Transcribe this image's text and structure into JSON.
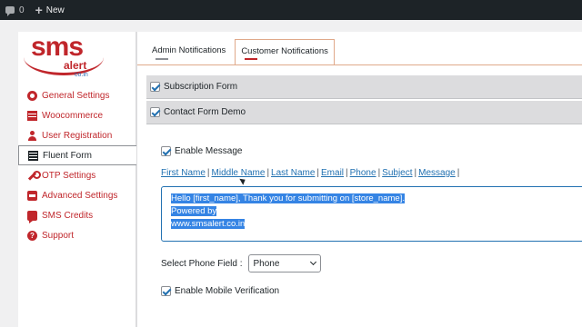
{
  "adminbar": {
    "comments_count": "0",
    "new_label": "New"
  },
  "logo": {
    "text_sms": "sms",
    "text_alert": "alert",
    "text_domain": "co.in"
  },
  "sidebar": {
    "items": [
      {
        "label": "General Settings",
        "icon": "gear-icon"
      },
      {
        "label": "Woocommerce",
        "icon": "table-icon"
      },
      {
        "label": "User Registration",
        "icon": "user-icon"
      },
      {
        "label": "Fluent Form",
        "icon": "form-icon",
        "active": true
      },
      {
        "label": "OTP Settings",
        "icon": "wrench-icon"
      },
      {
        "label": "Advanced Settings",
        "icon": "advanced-icon"
      },
      {
        "label": "SMS Credits",
        "icon": "chat-icon"
      },
      {
        "label": "Support",
        "icon": "help-icon"
      }
    ]
  },
  "tabs": [
    {
      "label": "Admin Notifications"
    },
    {
      "label": "Customer Notifications",
      "active": true
    }
  ],
  "accordions": [
    {
      "label": "Subscription Form",
      "checked": true
    },
    {
      "label": "Contact Form Demo",
      "checked": true
    }
  ],
  "panel": {
    "enable_message": "Enable Message",
    "tokens": [
      "First Name",
      "Middle Name",
      "Last Name",
      "Email",
      "Phone",
      "Subject",
      "Message"
    ],
    "message_lines": [
      "Hello [first_name], Thank you for submitting on [store_name].",
      "Powered by",
      "www.smsalert.co.in"
    ],
    "phone_field_label": "Select Phone Field :",
    "phone_field_value": "Phone",
    "enable_mobile_verification": "Enable Mobile Verification"
  },
  "colors": {
    "accent": "#c0262b",
    "link": "#2271b1",
    "adminbar": "#1d2327"
  }
}
